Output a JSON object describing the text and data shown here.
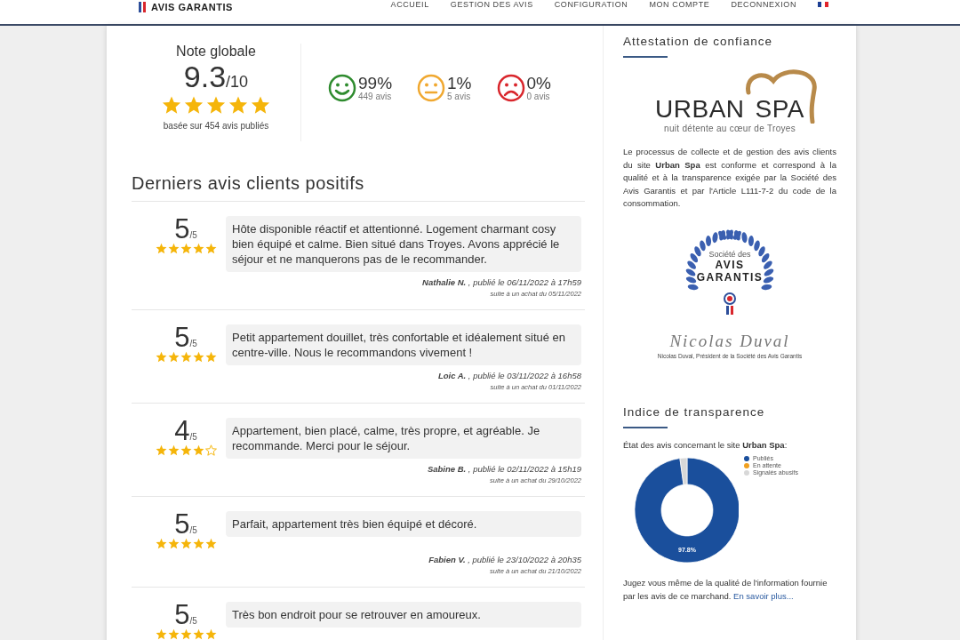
{
  "header": {
    "logo_text": "AVIS GARANTIS",
    "nav": [
      {
        "label": "ACCUEIL"
      },
      {
        "label": "GESTION DES AVIS"
      },
      {
        "label": "CONFIGURATION"
      },
      {
        "label": "MON COMPTE"
      },
      {
        "label": "DECONNEXION"
      }
    ]
  },
  "summary": {
    "title": "Note globale",
    "score": "9.3",
    "scale": "/10",
    "stars": 5,
    "caption": "basée sur 454 avis publiés",
    "sentiments": [
      {
        "kind": "positive",
        "color": "#2e8b2e",
        "percent": "99%",
        "count": "449 avis"
      },
      {
        "kind": "neutral",
        "color": "#f0a830",
        "percent": "1%",
        "count": "5 avis"
      },
      {
        "kind": "negative",
        "color": "#d9262c",
        "percent": "0%",
        "count": "0 avis"
      }
    ]
  },
  "reviews_title": "Derniers avis clients positifs",
  "reviews": [
    {
      "score": "5",
      "scale": "/5",
      "stars": 5,
      "text": "Hôte disponible réactif et attentionné. Logement charmant cosy bien équipé et calme. Bien situé dans Troyes. Avons apprécié le séjour et ne manquerons pas de le recommander.",
      "author": "Nathalie N.",
      "published": ", publié le 06/11/2022 à 17h59",
      "purchase": "suite à un achat du 05/11/2022"
    },
    {
      "score": "5",
      "scale": "/5",
      "stars": 5,
      "text": "Petit appartement douillet, très confortable et idéalement situé en centre-ville. Nous le recommandons vivement !",
      "author": "Loic A.",
      "published": ", publié le 03/11/2022 à 16h58",
      "purchase": "suite à un achat du 01/11/2022"
    },
    {
      "score": "4",
      "scale": "/5",
      "stars": 4,
      "text": "Appartement, bien placé, calme, très propre, et agréable. Je recommande. Merci pour le séjour.",
      "author": "Sabine B.",
      "published": ", publié le 02/11/2022 à 15h19",
      "purchase": "suite à un achat du 29/10/2022"
    },
    {
      "score": "5",
      "scale": "/5",
      "stars": 5,
      "text": "Parfait, appartement très bien équipé et décoré.",
      "author": "Fabien V.",
      "published": ", publié le 23/10/2022 à 20h35",
      "purchase": "suite à un achat du 21/10/2022"
    },
    {
      "score": "5",
      "scale": "/5",
      "stars": 5,
      "text": "Très bon endroit pour se retrouver en amoureux."
    }
  ],
  "sidebar": {
    "attestation_title": "Attestation de confiance",
    "merchant_logo": {
      "name_left": "URBAN",
      "name_right": "SPA",
      "tagline": "nuit détente au cœur de Troyes"
    },
    "attestation_text": "Le processus de collecte et de gestion des avis clients du site **Urban Spa** est conforme et correspond à la qualité et à la transparence exigée par la Société des Avis Garantis et par l'Article L111-7-2 du code de la consommation.",
    "seal": {
      "top": "Société des",
      "line1": "AVIS",
      "line2": "GARANTIS"
    },
    "signature": "Nicolas Duval",
    "signature_caption": "Nicolas Duval, Président de la Société des Avis Garantis",
    "transparency_title": "Indice de transparence",
    "transparency_intro": "État des avis concernant le site **Urban Spa**:",
    "chart_data": {
      "type": "donut",
      "categories": [
        "Publiés",
        "En attente",
        "Signalés abusifs"
      ],
      "values": [
        97.8,
        0,
        2.2
      ],
      "colors": [
        "#1a4f9c",
        "#f0a020",
        "#d8d8d8"
      ],
      "value_labels": [
        "97.8%",
        null,
        null
      ],
      "legend": "right"
    },
    "footer_text": "Jugez vous même de la qualité de l'information fournie par les avis de ce marchand.",
    "footer_link": "En savoir plus..."
  }
}
